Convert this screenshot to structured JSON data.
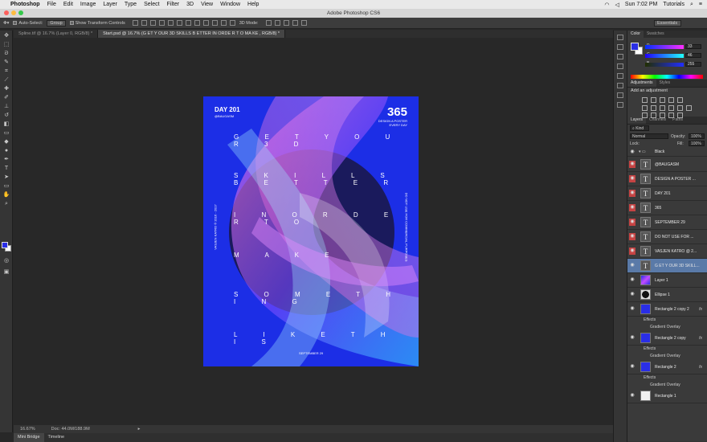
{
  "menubar": {
    "app_name": "Photoshop",
    "items": [
      "File",
      "Edit",
      "Image",
      "Layer",
      "Type",
      "Select",
      "Filter",
      "3D",
      "View",
      "Window",
      "Help"
    ],
    "clock": "Sun 7:02 PM",
    "user": "Tutorials"
  },
  "window": {
    "title": "Adobe Photoshop CS6"
  },
  "options": {
    "auto_select_label": "Auto-Select:",
    "auto_select_value": "Group",
    "transform_label": "Show Transform Controls",
    "mode_3d_label": "3D Mode:",
    "workspace": "Essentials"
  },
  "tabs": [
    {
      "label": "Spline.tif @ 16.7% (Layer 0, RGB/8) *",
      "active": false
    },
    {
      "label": "Start.psd @ 16.7% (G ET Y  OUR 3D  SKILLS B  ETTER   IN ORDE R T  O  MA       KE , RGB/8) *",
      "active": true
    }
  ],
  "status": {
    "zoom": "16.67%",
    "doc": "Doc: 44.0M/188.9M"
  },
  "bottom_tabs": [
    "Mini Bridge",
    "Timeline"
  ],
  "poster": {
    "day": "DAY 201",
    "handle": "@BAUGASM",
    "number": "365",
    "subtitle_1": "DESIGN A POSTER",
    "subtitle_2": "EVERY DAY",
    "lines": [
      "G E T Y  O U R  3 D",
      "S K I L L S  B  E T T E R",
      "I N  O R D E R  T O",
      "M A    K E",
      "S O M E    T H I N G",
      "L I K E  T  H I S"
    ],
    "side_left": "VASJEN KATRO © 2016 - 2017",
    "side_right": "DO NOT USE FOR COMMERCIAL PURPOSES",
    "date": "SEPTEMBER 29"
  },
  "color_panel": {
    "tabs": [
      "Color",
      "Swatches"
    ],
    "r": "33",
    "g": "46",
    "b": "255",
    "fg_color": "#2a2ee6"
  },
  "adjust_panel": {
    "tabs": [
      "Adjustments",
      "Styles"
    ],
    "label": "Add an adjustment"
  },
  "layers_panel": {
    "tabs": [
      "Layers",
      "Channels",
      "Paths"
    ],
    "kind_label": "Kind",
    "blend": "Normal",
    "opacity_label": "Opacity:",
    "opacity": "100%",
    "lock_label": "Lock:",
    "fill_label": "Fill:",
    "fill": "100%",
    "group_name": "Black",
    "layers": [
      {
        "name": "@BAUGASM",
        "kind": "text",
        "red": true
      },
      {
        "name": "DESIGN A POSTER ...",
        "kind": "text",
        "red": true
      },
      {
        "name": "DAY 201",
        "kind": "text",
        "red": true
      },
      {
        "name": "365",
        "kind": "text",
        "red": true
      },
      {
        "name": "SEPTEMBER 29",
        "kind": "text",
        "red": true
      },
      {
        "name": "DO NOT USE FOR ...",
        "kind": "text",
        "red": true
      },
      {
        "name": "VASJEN KATRO @ 2...",
        "kind": "text",
        "red": true
      },
      {
        "name": "G ET Y  OUR 3D  SKILL...",
        "kind": "text",
        "selected": true
      },
      {
        "name": "Layer 1",
        "kind": "image"
      },
      {
        "name": "Ellipse 1",
        "kind": "ellipse"
      },
      {
        "name": "Rectangle 2 copy 2",
        "kind": "rect",
        "fx": true
      },
      {
        "name": "Rectangle 2 copy",
        "kind": "rect",
        "fx": true
      },
      {
        "name": "Rectangle 2",
        "kind": "rect",
        "fx": true
      },
      {
        "name": "Rectangle 1",
        "kind": "white"
      }
    ],
    "effects_label": "Effects",
    "gradient_label": "Gradient Overlay"
  }
}
